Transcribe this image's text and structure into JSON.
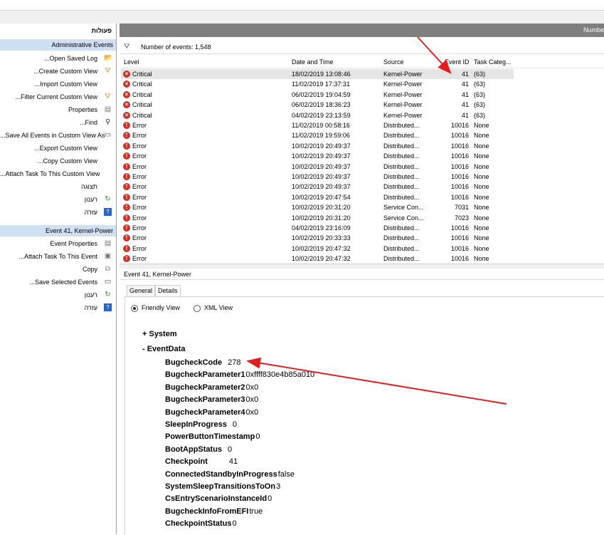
{
  "actions": {
    "title": "פעולות",
    "section1": "Administrative Events",
    "items1": [
      {
        "label": "...Open Saved Log",
        "icon": "folder-icon"
      },
      {
        "label": "...Create Custom View",
        "icon": "filter-icon"
      },
      {
        "label": "...Import Custom View",
        "icon": ""
      },
      {
        "label": "...Filter Current Custom View",
        "icon": "filter-icon"
      },
      {
        "label": "Properties",
        "icon": "properties-icon"
      },
      {
        "label": "...Find",
        "icon": "binoculars-icon"
      },
      {
        "label": "...Save All Events in Custom View As",
        "icon": "save-icon"
      },
      {
        "label": "...Export Custom View",
        "icon": ""
      },
      {
        "label": "...Copy Custom View",
        "icon": ""
      },
      {
        "label": "...Attach Task To This Custom View",
        "icon": ""
      },
      {
        "label": "תצוגה",
        "icon": ""
      },
      {
        "label": "רענון",
        "icon": "refresh-icon"
      },
      {
        "label": "עזרה",
        "icon": "help-icon"
      }
    ],
    "section2": "Event 41, Kernel-Power",
    "items2": [
      {
        "label": "Event Properties",
        "icon": "properties-icon"
      },
      {
        "label": "...Attach Task To This Event",
        "icon": "task-icon"
      },
      {
        "label": "Copy",
        "icon": "copy-icon"
      },
      {
        "label": "...Save Selected Events",
        "icon": "save-icon"
      },
      {
        "label": "רענון",
        "icon": "refresh-icon"
      },
      {
        "label": "עזרה",
        "icon": "help-icon"
      }
    ]
  },
  "header": {
    "right_label": "Numbe"
  },
  "filter": {
    "text": "Number of events: 1,548"
  },
  "table": {
    "columns": [
      "Level",
      "Date and Time",
      "Source",
      "Event ID",
      "Task Categ..."
    ],
    "rows": [
      {
        "level": "Critical",
        "date": "18/02/2019 13:08:46",
        "source": "Kernel-Power",
        "id": "41",
        "task": "(63)"
      },
      {
        "level": "Critical",
        "date": "11/02/2019 17:37:31",
        "source": "Kernel-Power",
        "id": "41",
        "task": "(63)"
      },
      {
        "level": "Critical",
        "date": "06/02/2019 19:04:59",
        "source": "Kernel-Power",
        "id": "41",
        "task": "(63)"
      },
      {
        "level": "Critical",
        "date": "06/02/2019 18:36:23",
        "source": "Kernel-Power",
        "id": "41",
        "task": "(63)"
      },
      {
        "level": "Critical",
        "date": "04/02/2019 23:13:59",
        "source": "Kernel-Power",
        "id": "41",
        "task": "(63)"
      },
      {
        "level": "Error",
        "date": "11/02/2019 00:58:16",
        "source": "Distributed...",
        "id": "10016",
        "task": "None"
      },
      {
        "level": "Error",
        "date": "11/02/2019 19:59:06",
        "source": "Distributed...",
        "id": "10016",
        "task": "None"
      },
      {
        "level": "Error",
        "date": "10/02/2019 20:49:37",
        "source": "Distributed...",
        "id": "10016",
        "task": "None"
      },
      {
        "level": "Error",
        "date": "10/02/2019 20:49:37",
        "source": "Distributed...",
        "id": "10016",
        "task": "None"
      },
      {
        "level": "Error",
        "date": "10/02/2019 20:49:37",
        "source": "Distributed...",
        "id": "10016",
        "task": "None"
      },
      {
        "level": "Error",
        "date": "10/02/2019 20:49:37",
        "source": "Distributed...",
        "id": "10016",
        "task": "None"
      },
      {
        "level": "Error",
        "date": "10/02/2019 20:49:37",
        "source": "Distributed...",
        "id": "10016",
        "task": "None"
      },
      {
        "level": "Error",
        "date": "10/02/2019 20:47:54",
        "source": "Distributed...",
        "id": "10016",
        "task": "None"
      },
      {
        "level": "Error",
        "date": "10/02/2019 20:31:20",
        "source": "Service Con...",
        "id": "7031",
        "task": "None"
      },
      {
        "level": "Error",
        "date": "10/02/2019 20:31:20",
        "source": "Service Con...",
        "id": "7023",
        "task": "None"
      },
      {
        "level": "Error",
        "date": "04/02/2019 23:16:09",
        "source": "Distributed...",
        "id": "10016",
        "task": "None"
      },
      {
        "level": "Error",
        "date": "10/02/2019 20:33:33",
        "source": "Distributed...",
        "id": "10016",
        "task": "None"
      },
      {
        "level": "Error",
        "date": "10/02/2019 20:47:32",
        "source": "Distributed...",
        "id": "10016",
        "task": "None"
      },
      {
        "level": "Error",
        "date": "10/02/2019 20:47:32",
        "source": "Distributed...",
        "id": "10016",
        "task": "None"
      }
    ]
  },
  "detail": {
    "title": "Event 41, Kernel-Power",
    "tabs": [
      "General",
      "Details"
    ],
    "radios": [
      "Friendly View",
      "XML View"
    ],
    "tree": [
      "+ System",
      "- EventData"
    ],
    "fields": [
      {
        "k": "BugcheckCode",
        "v": "278"
      },
      {
        "k": "BugcheckParameter1",
        "v": "0xffff830e4b85a010"
      },
      {
        "k": "BugcheckParameter2",
        "v": "0x0"
      },
      {
        "k": "BugcheckParameter3",
        "v": "0x0"
      },
      {
        "k": "BugcheckParameter4",
        "v": "0x0"
      },
      {
        "k": "SleepInProgress",
        "v": "0"
      },
      {
        "k": "PowerButtonTimestamp",
        "v": "0"
      },
      {
        "k": "BootAppStatus",
        "v": "0"
      },
      {
        "k": "Checkpoint",
        "v": "41"
      },
      {
        "k": "ConnectedStandbyInProgress",
        "v": "false"
      },
      {
        "k": "SystemSleepTransitionsToOn",
        "v": "3"
      },
      {
        "k": "CsEntryScenarioInstanceId",
        "v": "0"
      },
      {
        "k": "BugcheckInfoFromEFI",
        "v": "true"
      },
      {
        "k": "CheckpointStatus",
        "v": "0"
      }
    ]
  },
  "colors": {
    "critical": "#c8342a",
    "arrow": "#e02020",
    "section": "#cfe0f3"
  }
}
